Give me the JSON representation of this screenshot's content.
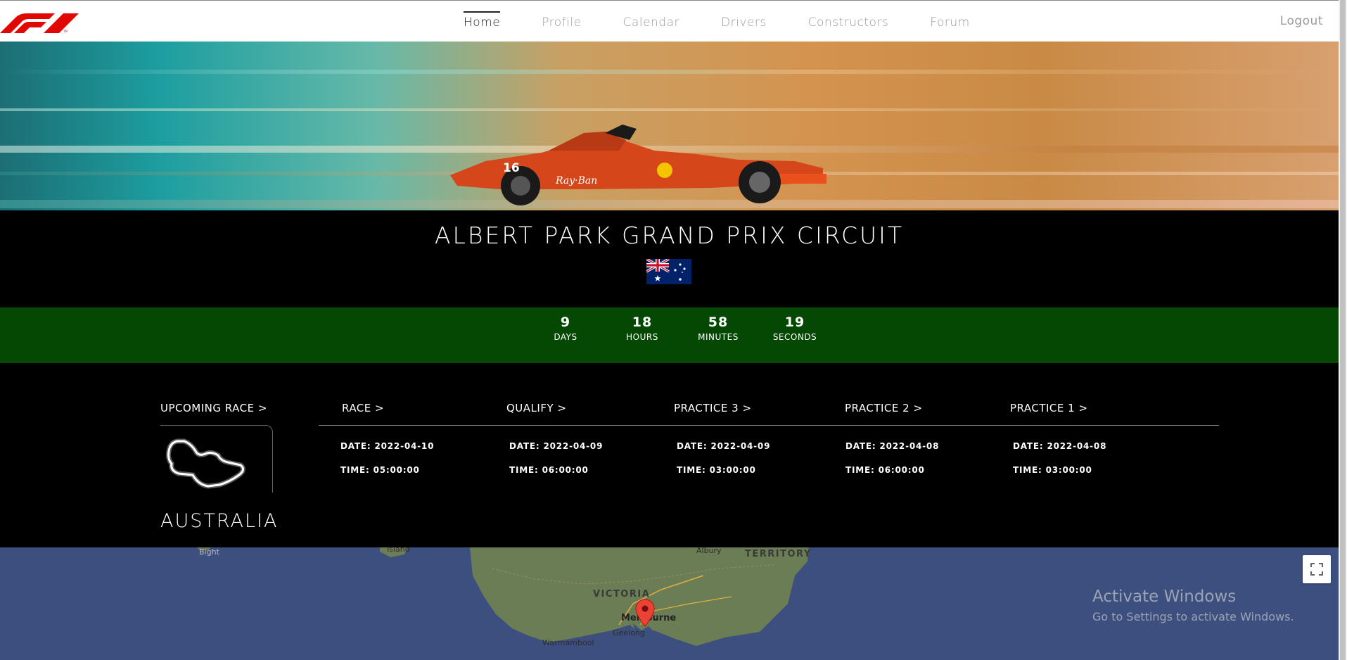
{
  "nav": {
    "logo": "f1-logo",
    "links": [
      "Home",
      "Profile",
      "Calendar",
      "Drivers",
      "Constructors",
      "Forum"
    ],
    "active": "Home",
    "logout": "Logout"
  },
  "hero": {
    "image": "f1-car-motion-blur"
  },
  "circuit": {
    "name": "ALBERT PARK GRAND PRIX CIRCUIT",
    "flag": "australia-flag"
  },
  "countdown": {
    "days": "9",
    "days_label": "DAYS",
    "hours": "18",
    "hours_label": "HOURS",
    "minutes": "58",
    "minutes_label": "MINUTES",
    "seconds": "19",
    "seconds_label": "SECONDS"
  },
  "schedule": {
    "upcoming_label": "UPCOMING RACE >",
    "country": "AUSTRALIA",
    "sessions": [
      {
        "title": "RACE >",
        "date": "DATE: 2022-04-10",
        "time": "TIME: 05:00:00"
      },
      {
        "title": "QUALIFY >",
        "date": "DATE: 2022-04-09",
        "time": "TIME: 06:00:00"
      },
      {
        "title": "PRACTICE 3 >",
        "date": "DATE: 2022-04-09",
        "time": "TIME: 03:00:00"
      },
      {
        "title": "PRACTICE 2 >",
        "date": "DATE: 2022-04-08",
        "time": "TIME: 06:00:00"
      },
      {
        "title": "PRACTICE 1 >",
        "date": "DATE: 2022-04-08",
        "time": "TIME: 03:00:00"
      }
    ]
  },
  "map": {
    "labels": {
      "bight": "Bight",
      "island": "Island",
      "albury": "Albury",
      "territory": "TERRITORY",
      "victoria": "VICTORIA",
      "melbourne": "Melbourne",
      "geelong": "Geelong",
      "warrnambool": "Warrnambool"
    },
    "fullscreen_icon": "fullscreen-icon",
    "marker_icon": "map-pin-icon"
  },
  "watermark": {
    "title": "Activate Windows",
    "subtitle": "Go to Settings to activate Windows."
  }
}
